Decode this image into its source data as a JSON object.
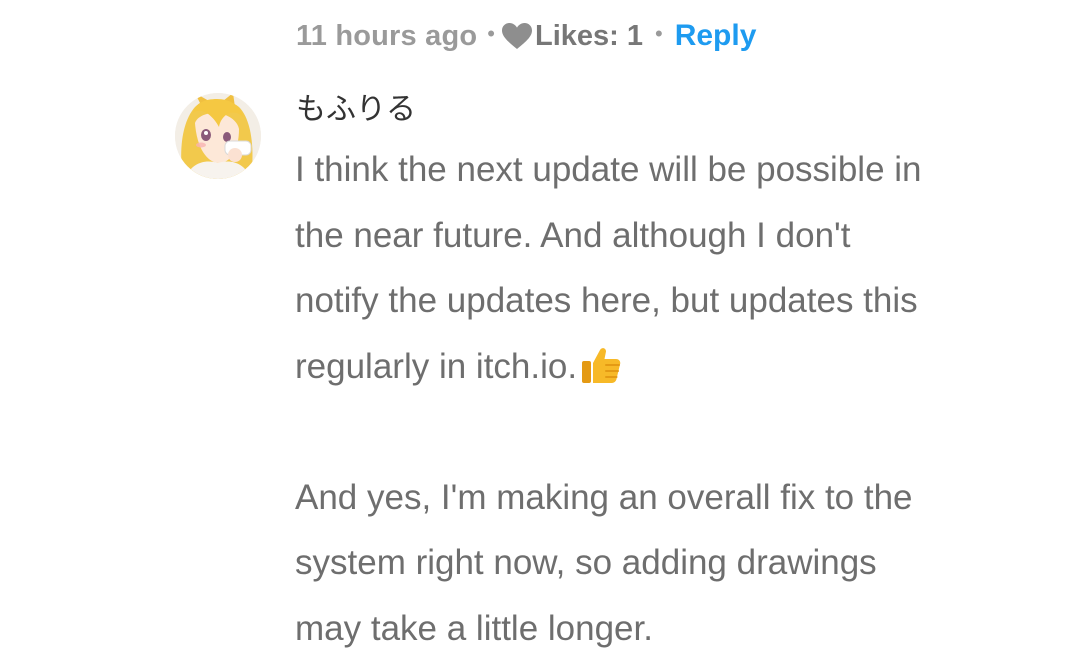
{
  "comment": {
    "meta": {
      "time": "11 hours ago",
      "separator": "•",
      "likes": "Likes: 1",
      "reply": "Reply"
    },
    "author": "もふりる",
    "body": {
      "line1": "I think the next update will be possible in",
      "line2": "the near future. And although I don't",
      "line3": "notify the updates here, but updates this",
      "line4": "regularly in itch.io.",
      "line5": "And yes, I'm making an overall fix to the",
      "line6": "system right now, so adding drawings",
      "line7": "may take a little longer."
    },
    "icons": {
      "heart": "heart-icon",
      "thumb": "thumbs-up-icon",
      "avatar": "anime-girl-avatar"
    },
    "colors": {
      "reply": "#1e9bf0",
      "meta": "#9a9a9a",
      "body": "#6e6e6e",
      "author": "#333333"
    }
  }
}
